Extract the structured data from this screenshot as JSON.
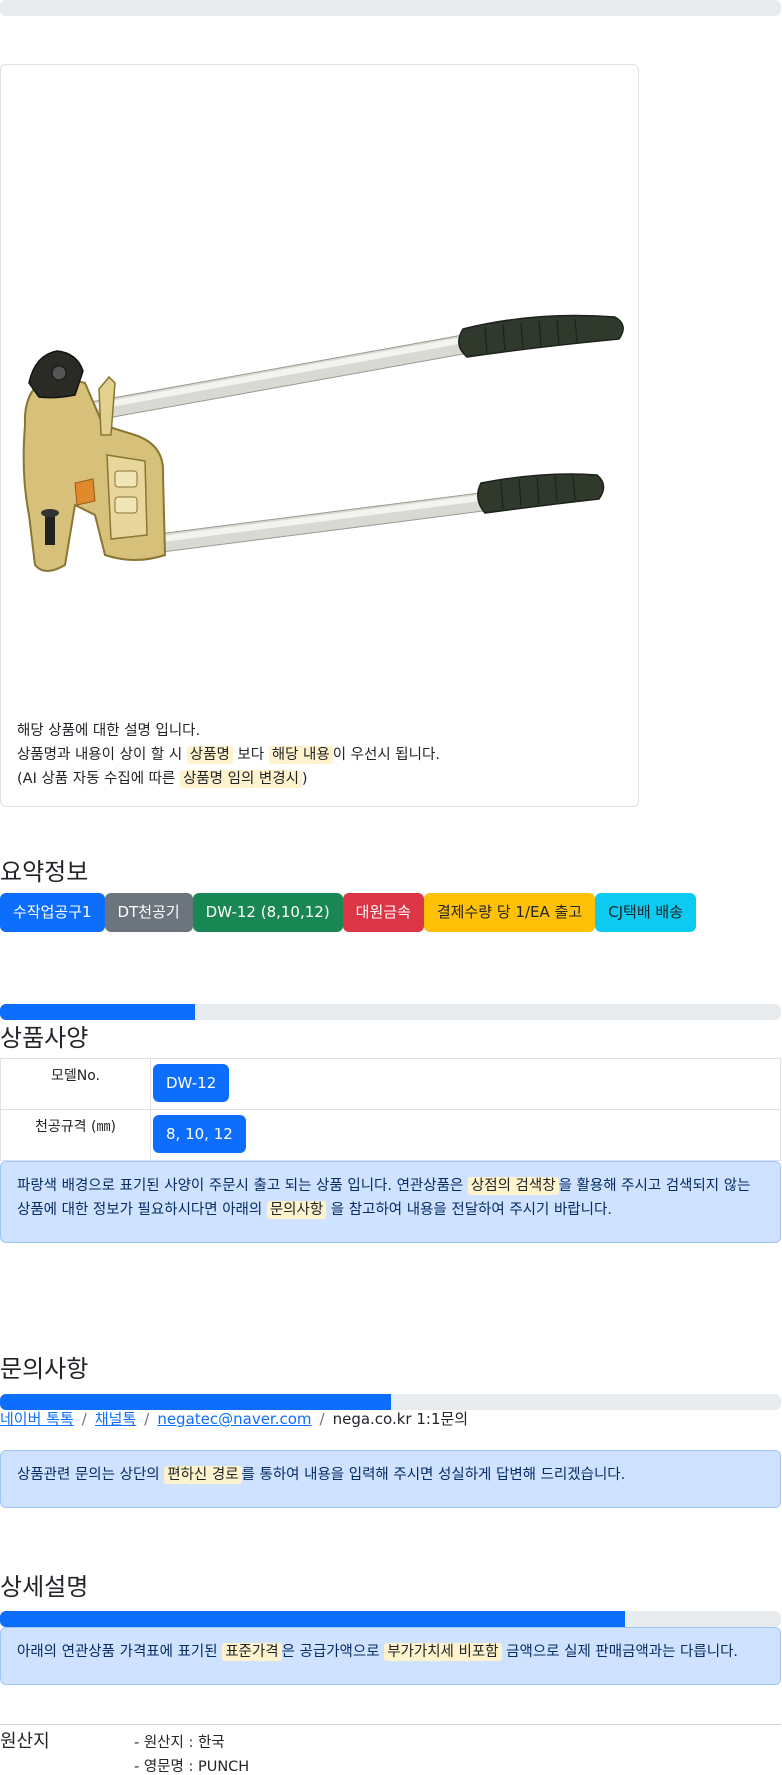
{
  "top_progress": {
    "percent": 0
  },
  "product": {
    "image_name": "punch-tool-image",
    "description_line1": "해당 상품에 대한 설명 입니다.",
    "description_line2": {
      "part1": "상품명과 내용이 상이 할 시 ",
      "hl1": "상품명",
      "part2": " 보다 ",
      "hl2": "해당 내용",
      "part3": "이 우선시 됩니다."
    },
    "description_line3": {
      "part1": "(AI 상품 자동 수집에 따른 ",
      "hl1": "상품명 임의 변경시",
      "part2": ")"
    }
  },
  "summary": {
    "title": "요약정보",
    "badges": [
      {
        "label": "수작업공구1",
        "color": "#0d6efd",
        "text_color": "#ffffff"
      },
      {
        "label": "DT천공기",
        "color": "#6c757d",
        "text_color": "#ffffff"
      },
      {
        "label": "DW-12 (8,10,12)",
        "color": "#198754",
        "text_color": "#ffffff"
      },
      {
        "label": "대원금속",
        "color": "#dc3545",
        "text_color": "#ffffff"
      },
      {
        "label": "결제수량 당 1/EA 출고",
        "color": "#ffc107",
        "text_color": "#212529"
      },
      {
        "label": "CJ택배 배송",
        "color": "#0dcaf0",
        "text_color": "#212529"
      }
    ]
  },
  "specs": {
    "progress_percent": 25,
    "title": "상품사양",
    "rows": [
      {
        "label": "모델No.",
        "value": "DW-12"
      },
      {
        "label": "천공규격 (㎜)",
        "value": "8, 10, 12"
      }
    ],
    "notice": {
      "part1": "파랑색 배경으로 표기된 사양이 주문시 출고 되는 상품 입니다. 연관상품은 ",
      "hl1": "상점의 검색창",
      "part2": "을 활용해 주시고 검색되지 않는 상품에 대한 정보가 필요하시다면 아래의 ",
      "hl2": "문의사항",
      "part3": " 을 참고하여 내용을 전달하여 주시기 바랍니다."
    }
  },
  "inquiry": {
    "title": "문의사항",
    "progress_percent": 50,
    "links": [
      "네이버 톡톡",
      "채널톡",
      "negatec@naver.com"
    ],
    "plain": "nega.co.kr 1:1문의",
    "separator": "/",
    "notice": {
      "part1": "상품관련 문의는 상단의 ",
      "hl1": "편하신 경로",
      "part2": "를 통하여 내용을 입력해 주시면 성실하게 답변해 드리겠습니다."
    }
  },
  "detail": {
    "title": "상세설명",
    "progress_percent": 80,
    "notice": {
      "part1": "아래의 연관상품 가격표에 표기된 ",
      "hl1": "표준가격",
      "part2": "은 공급가액으로 ",
      "hl2": "부가가치세 비포함",
      "part3": " 금액으로 실제 판매금액과는 다릅니다."
    }
  },
  "origin": {
    "label": "원산지",
    "items": [
      "- 원산지 : 한국",
      "- 영문명 : PUNCH"
    ]
  }
}
